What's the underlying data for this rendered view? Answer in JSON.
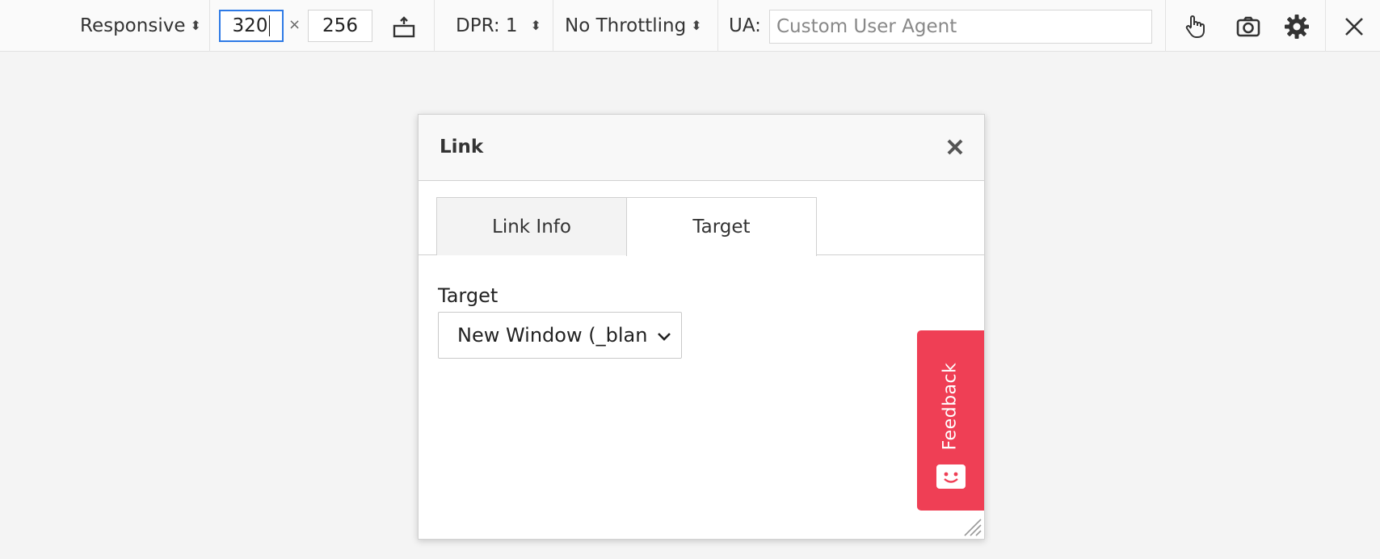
{
  "toolbar": {
    "device": "Responsive",
    "width": "320",
    "times": "×",
    "height": "256",
    "dpr": "DPR: 1",
    "throttling": "No Throttling",
    "ua_label": "UA:",
    "ua_placeholder": "Custom User Agent",
    "arrows_glyph": "⬍"
  },
  "dialog": {
    "title": "Link",
    "tabs": [
      {
        "label": "Link Info",
        "active": false
      },
      {
        "label": "Target",
        "active": true
      }
    ],
    "field_label": "Target",
    "select_value": "New Window (_blan"
  },
  "feedback": {
    "label": "Feedback",
    "color": "#ef3f55"
  },
  "colors": {
    "focus_blue": "#2e7ae6",
    "page_bg": "#f4f4f4"
  }
}
